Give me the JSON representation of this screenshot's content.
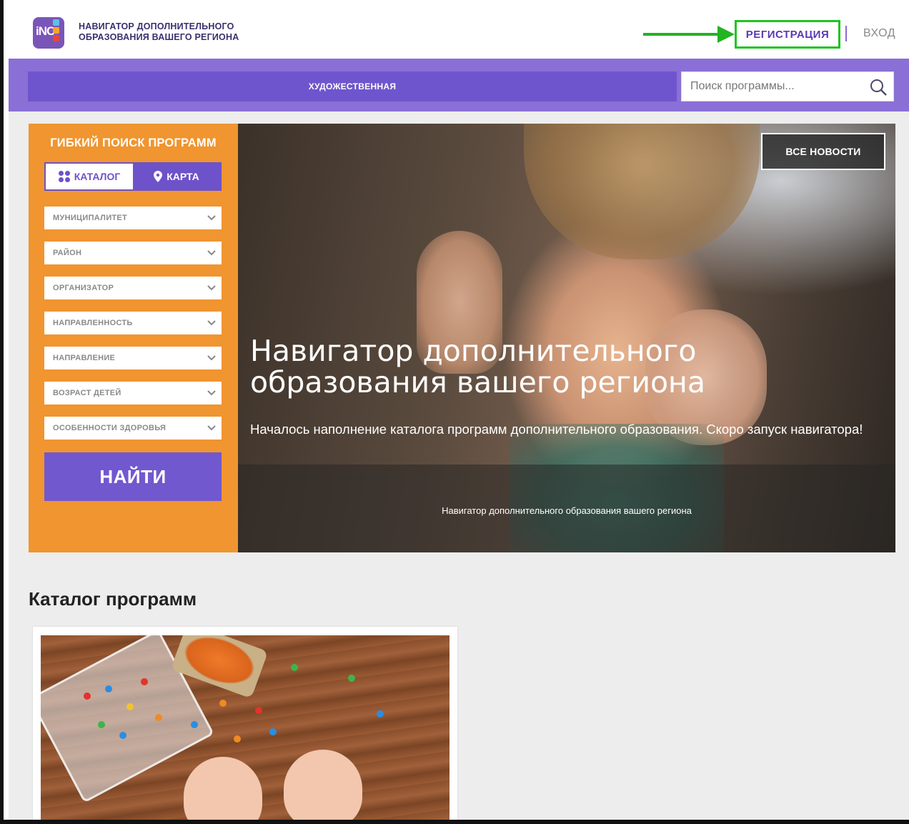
{
  "header": {
    "site_title_line1": "НАВИГАТОР ДОПОЛНИТЕЛЬНОГО",
    "site_title_line2": "ОБРАЗОВАНИЯ ВАШЕГО РЕГИОНА",
    "logo_text": "iNC",
    "register_label": "РЕГИСТРАЦИЯ",
    "login_label": "ВХОД"
  },
  "nav": {
    "category_label": "ХУДОЖЕСТВЕННАЯ",
    "search_placeholder": "Поиск программы..."
  },
  "filter": {
    "title": "ГИБКИЙ ПОИСК ПРОГРАММ",
    "tab_catalog": "КАТАЛОГ",
    "tab_map": "КАРТА",
    "selects": [
      "МУНИЦИПАЛИТЕТ",
      "РАЙОН",
      "ОРГАНИЗАТОР",
      "НАПРАВЛЕННОСТЬ",
      "НАПРАВЛЕНИЕ",
      "ВОЗРАСТ ДЕТЕЙ",
      "ОСОБЕННОСТИ ЗДОРОВЬЯ"
    ],
    "find_label": "НАЙТИ"
  },
  "hero": {
    "all_news_label": "ВСЕ НОВОСТИ",
    "title": "Навигатор дополнительного образования вашего региона",
    "subtitle": "Началось наполнение каталога программ дополнительного образования. Скоро запуск навигатора!",
    "caption": "Навигатор дополнительного образования вашего региона"
  },
  "catalog": {
    "title": "Каталог программ"
  },
  "colors": {
    "purple": "#6f55cd",
    "orange": "#f0952f",
    "highlight_green": "#1ec51e"
  }
}
